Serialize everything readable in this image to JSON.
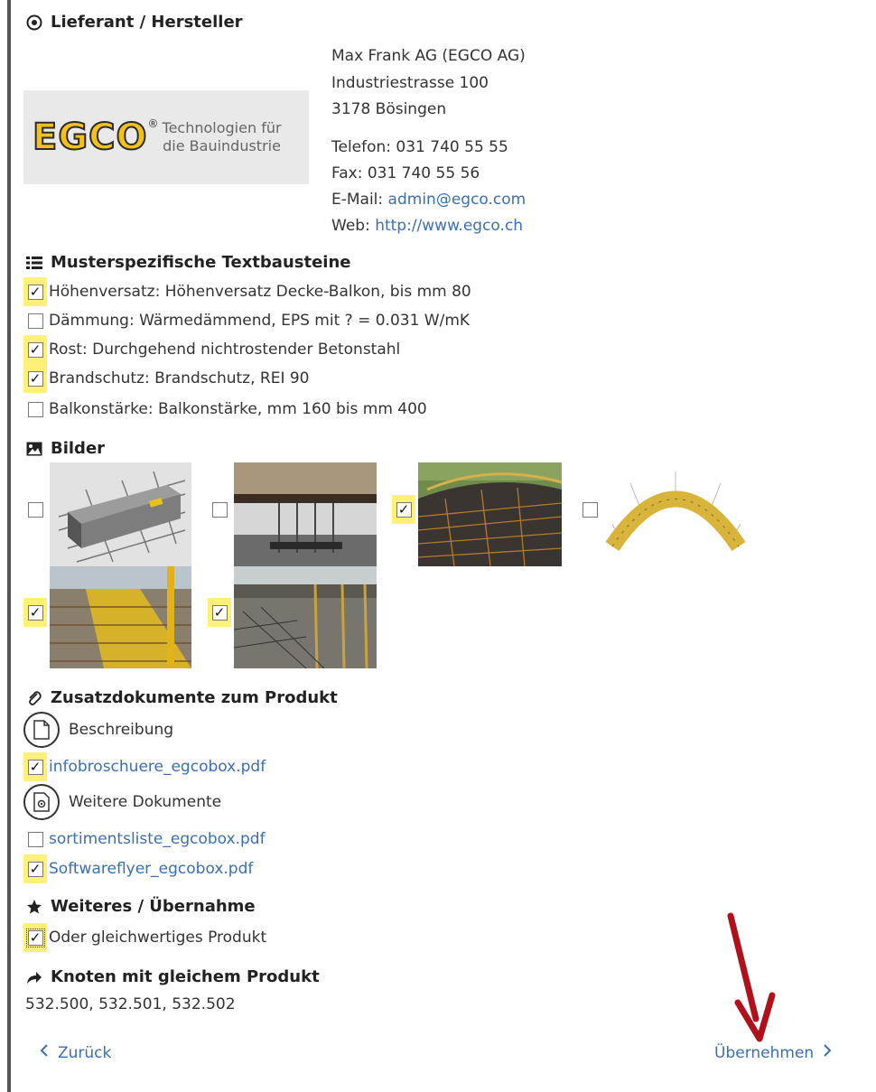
{
  "supplier": {
    "section_title": "Lieferant / Hersteller",
    "logo": {
      "wordmark": "EGCO",
      "registered": "®",
      "tagline_line1": "Technologien für",
      "tagline_line2": "die Bauindustrie"
    },
    "company": "Max Frank AG (EGCO AG)",
    "street": "Industriestrasse 100",
    "city": "3178 Bösingen",
    "phone": "Telefon: 031 740 55 55",
    "fax": "Fax: 031 740 55 56",
    "email_label": "E-Mail:",
    "email": "admin@egco.com",
    "web_label": "Web:",
    "web": "http://www.egco.ch"
  },
  "textblocks": {
    "section_title": "Musterspezifische Textbausteine",
    "items": [
      {
        "label": "Höhenversatz: Höhenversatz Decke-Balkon, bis mm 80",
        "checked": true
      },
      {
        "label": "Dämmung: Wärmedämmend, EPS mit ? = 0.031 W/mK",
        "checked": false
      },
      {
        "label": "Rost: Durchgehend nichtrostender Betonstahl",
        "checked": true
      },
      {
        "label": "Brandschutz: Brandschutz, REI 90",
        "checked": true
      },
      {
        "label": "Balkonstärke: Balkonstärke, mm 160 bis mm 400",
        "checked": false
      }
    ]
  },
  "images": {
    "section_title": "Bilder",
    "items": [
      {
        "name": "egcobox-3d-render",
        "checked": false
      },
      {
        "name": "balcony-connection-site",
        "checked": false
      },
      {
        "name": "curved-balcony-rebar",
        "checked": true
      },
      {
        "name": "curved-element-diagram",
        "checked": false
      },
      {
        "name": "installed-row-yellow",
        "checked": true
      },
      {
        "name": "installed-row-construction",
        "checked": true
      }
    ]
  },
  "documents": {
    "section_title": "Zusatzdokumente zum Produkt",
    "groups": [
      {
        "label": "Beschreibung",
        "files": [
          {
            "name": "infobroschuere_egcobox.pdf",
            "checked": true
          }
        ]
      },
      {
        "label": "Weitere Dokumente",
        "files": [
          {
            "name": "sortimentsliste_egcobox.pdf",
            "checked": false
          },
          {
            "name": "Softwareflyer_egcobox.pdf",
            "checked": true
          }
        ]
      }
    ]
  },
  "further": {
    "section_title": "Weiteres / Übernahme",
    "option_label": "Oder gleichwertiges Produkt",
    "option_checked": true
  },
  "nodes": {
    "section_title": "Knoten mit gleichem Produkt",
    "value": "532.500, 532.501, 532.502"
  },
  "navigation": {
    "back_label": "Zurück",
    "apply_label": "Übernehmen"
  },
  "colors": {
    "link": "#3a6fb5",
    "highlight": "#fff07a",
    "annotation_arrow": "#b0121b",
    "logo_yellow": "#f2c21a"
  }
}
